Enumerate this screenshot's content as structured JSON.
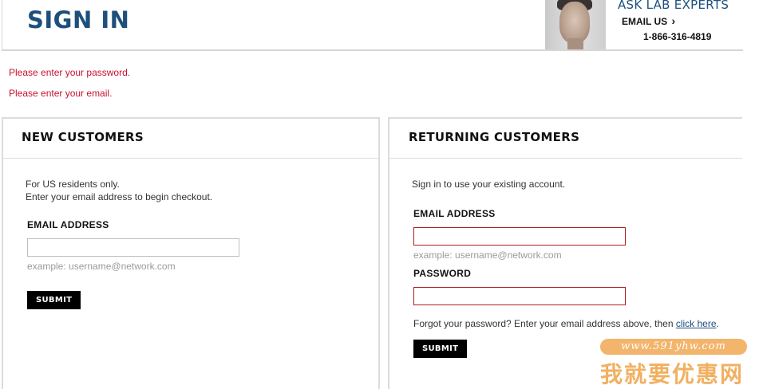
{
  "header": {
    "title": "SIGN IN",
    "experts_title": "ASK LAB EXPERTS",
    "email_us": "EMAIL US",
    "email_us_arrow": "›",
    "phone": "1-866-316-4819"
  },
  "errors": [
    "Please enter your password.",
    "Please enter your email."
  ],
  "new_customers": {
    "heading": "NEW CUSTOMERS",
    "line1": "For US residents only.",
    "line2": "Enter your email address to begin checkout.",
    "email_label": "EMAIL ADDRESS",
    "email_value": "",
    "email_hint": "example: username@network.com",
    "submit_label": "SUBMIT"
  },
  "returning_customers": {
    "heading": "RETURNING CUSTOMERS",
    "intro": "Sign in to use your existing account.",
    "email_label": "EMAIL ADDRESS",
    "email_value": "",
    "email_hint": "example: username@network.com",
    "password_label": "PASSWORD",
    "password_value": "",
    "forgot_text": "Forgot your password? Enter your email address above, then ",
    "forgot_link": "click here",
    "forgot_suffix": ".",
    "submit_label": "SUBMIT"
  },
  "watermark": {
    "url": "www.591yhw.com",
    "cn": "我就要优惠网"
  },
  "colors": {
    "brand_blue": "#1d4f7c",
    "error_red": "#c8102e",
    "button_black": "#000000",
    "watermark_orange": "#f0a850"
  }
}
